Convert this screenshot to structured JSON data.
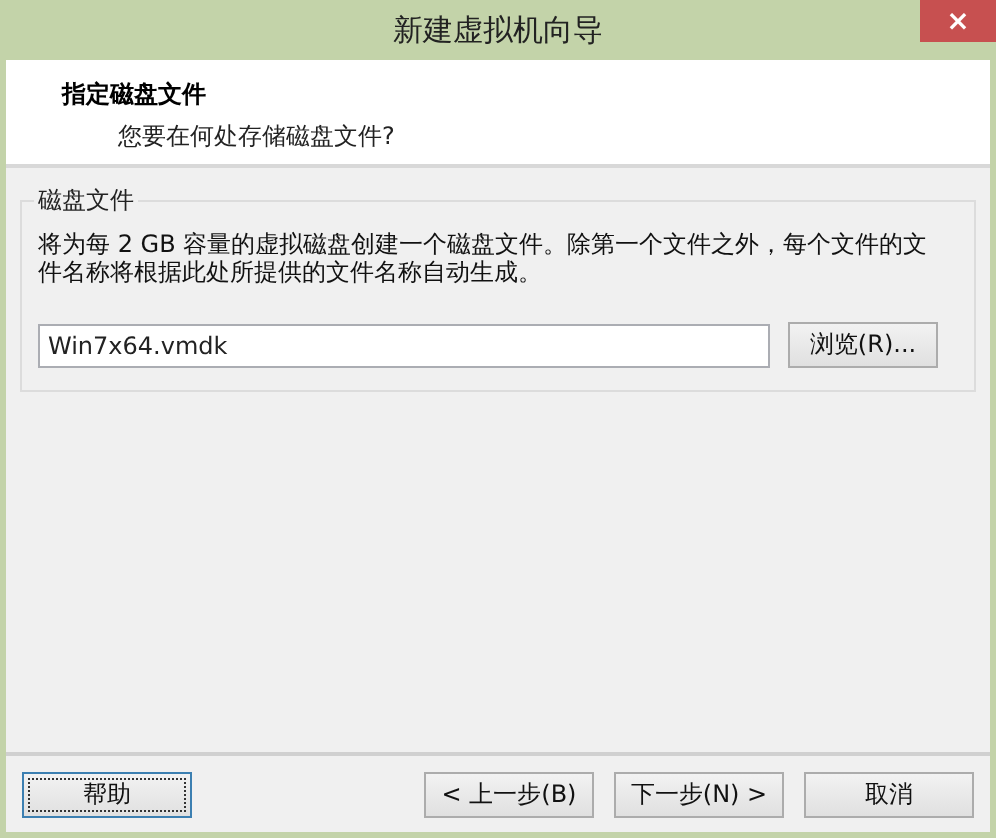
{
  "window": {
    "title": "新建虚拟机向导",
    "close": "×"
  },
  "header": {
    "title": "指定磁盘文件",
    "subtitle": "您要在何处存储磁盘文件?"
  },
  "group": {
    "title": "磁盘文件",
    "description": "将为每 2 GB 容量的虚拟磁盘创建一个磁盘文件。除第一个文件之外，每个文件的文件名称将根据此处所提供的文件名称自动生成。",
    "file": {
      "value": "Win7x64.vmdk"
    },
    "browse": "浏览(R)..."
  },
  "buttons": [
    {
      "label": "帮助",
      "focused": true
    },
    {
      "label": "< 上一步(B)",
      "focused": false
    },
    {
      "label": "下一步(N) >",
      "focused": false
    },
    {
      "label": "取消",
      "focused": false
    }
  ]
}
